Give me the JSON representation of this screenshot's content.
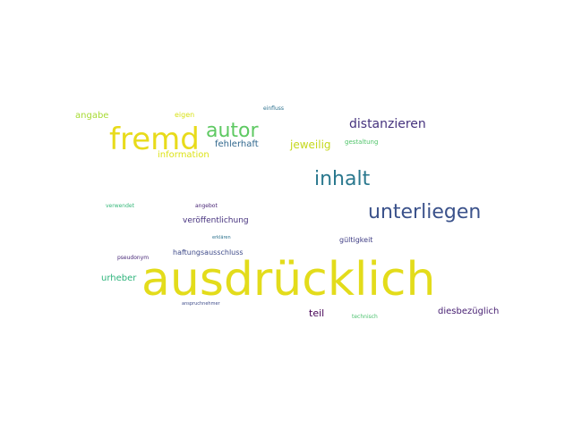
{
  "words": [
    {
      "text": "ausdrücklich",
      "color": "#e3dc1b"
    },
    {
      "text": "fremd",
      "color": "#e8db1b"
    },
    {
      "text": "autor",
      "color": "#5ec962"
    },
    {
      "text": "unterliegen",
      "color": "#3b528b"
    },
    {
      "text": "inhalt",
      "color": "#2a788e"
    },
    {
      "text": "distanzieren",
      "color": "#46337e"
    },
    {
      "text": "jeweilig",
      "color": "#c5d81c"
    },
    {
      "text": "fehlerhaft",
      "color": "#31688e"
    },
    {
      "text": "information",
      "color": "#dde318"
    },
    {
      "text": "angabe",
      "color": "#a8db34"
    },
    {
      "text": "eigen",
      "color": "#d8e219"
    },
    {
      "text": "einfluss",
      "color": "#2d718e"
    },
    {
      "text": "gestaltung",
      "color": "#50c46a"
    },
    {
      "text": "veröffentlichung",
      "color": "#46327e"
    },
    {
      "text": "angebot",
      "color": "#482475"
    },
    {
      "text": "verwendet",
      "color": "#35b779"
    },
    {
      "text": "haftungsausschluss",
      "color": "#3e4a89"
    },
    {
      "text": "gültigkeit",
      "color": "#424086"
    },
    {
      "text": "erklären",
      "color": "#2c728e"
    },
    {
      "text": "urheber",
      "color": "#2fb47c"
    },
    {
      "text": "pseudonym",
      "color": "#482878"
    },
    {
      "text": "anspruchnehmer",
      "color": "#3e4c8a"
    },
    {
      "text": "teil",
      "color": "#440154"
    },
    {
      "text": "technisch",
      "color": "#4ac16d"
    },
    {
      "text": "diesbezüglich",
      "color": "#482173"
    }
  ]
}
